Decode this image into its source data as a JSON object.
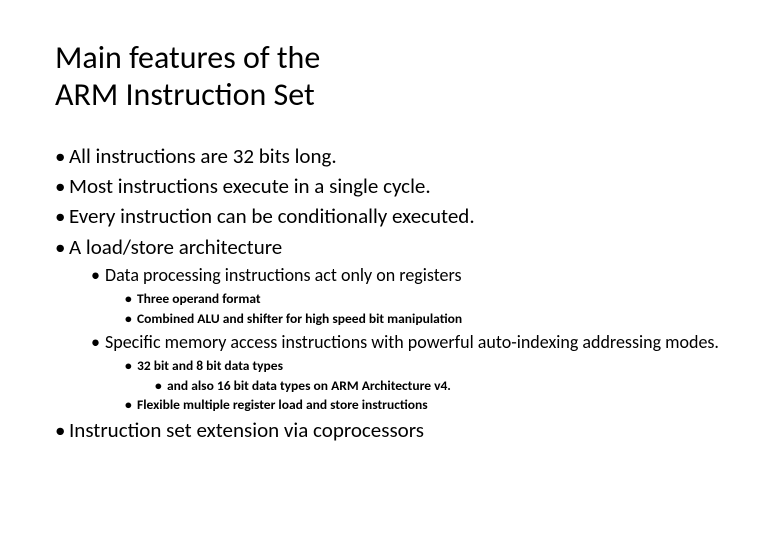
{
  "title_line1": "Main features of the",
  "title_line2": "ARM Instruction Set",
  "b1": "All instructions are 32 bits long.",
  "b2": "Most instructions execute in a single cycle.",
  "b3": "Every instruction can be conditionally executed.",
  "b4": "A load/store architecture",
  "b4_1": "Data processing instructions act only on registers",
  "b4_1_1": "Three operand format",
  "b4_1_2": "Combined ALU and shifter for high speed bit manipulation",
  "b4_2": "Specific memory access instructions with powerful auto-indexing addressing modes.",
  "b4_2_1": "32 bit and 8 bit data types",
  "b4_2_1_1": "and also 16 bit data types on ARM Architecture v4.",
  "b4_2_2": "Flexible multiple register load and store instructions",
  "b5": "Instruction set extension via coprocessors"
}
